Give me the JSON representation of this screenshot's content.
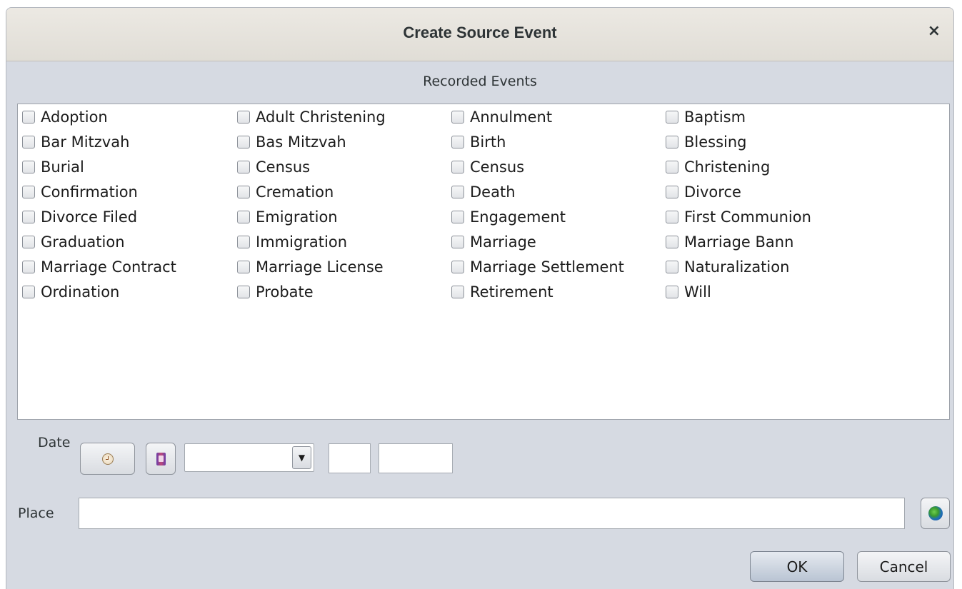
{
  "window": {
    "title": "Create Source Event",
    "close_glyph": "×"
  },
  "events_section": {
    "label": "Recorded Events",
    "items": [
      "Adoption",
      "Adult Christening",
      "Annulment",
      "Baptism",
      "Bar Mitzvah",
      "Bas Mitzvah",
      "Birth",
      "Blessing",
      "Burial",
      "Census",
      "Census",
      "Christening",
      "Confirmation",
      "Cremation",
      "Death",
      "Divorce",
      "Divorce Filed",
      "Emigration",
      "Engagement",
      "First Communion",
      "Graduation",
      "Immigration",
      "Marriage",
      "Marriage Bann",
      "Marriage Contract",
      "Marriage License",
      "Marriage Settlement",
      "Naturalization",
      "Ordination",
      "Probate",
      "Retirement",
      "Will"
    ]
  },
  "date": {
    "label": "Date",
    "clock_icon": "clock-icon",
    "calendar_icon": "calendar-icon",
    "combo_value": "",
    "combo_arrow": "▼",
    "day_value": "",
    "year_value": ""
  },
  "place": {
    "label": "Place",
    "value": "",
    "globe_icon": "globe-icon"
  },
  "buttons": {
    "ok_label": "OK",
    "cancel_label": "Cancel"
  }
}
